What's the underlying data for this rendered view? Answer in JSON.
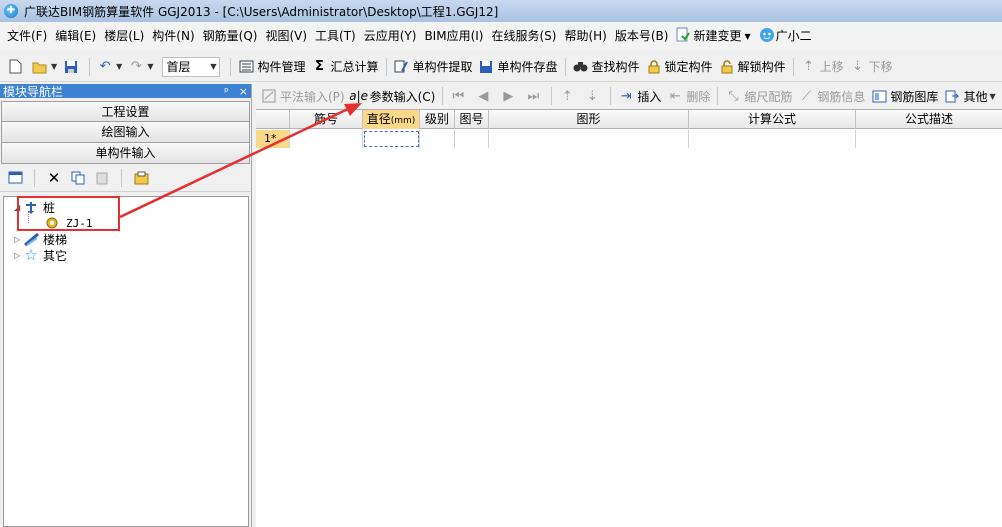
{
  "window": {
    "title": "广联达BIM钢筋算量软件 GGJ2013 - [C:\\Users\\Administrator\\Desktop\\工程1.GGJ12]"
  },
  "menu": {
    "items": [
      "文件(F)",
      "编辑(E)",
      "楼层(L)",
      "构件(N)",
      "钢筋量(Q)",
      "视图(V)",
      "工具(T)",
      "云应用(Y)",
      "BIM应用(I)",
      "在线服务(S)",
      "帮助(H)",
      "版本号(B)"
    ],
    "new_change": "新建变更",
    "assistant": "广小二"
  },
  "toolbar": {
    "floor": "首层",
    "component_manage": "构件管理",
    "summary_calc": "汇总计算",
    "single_extract": "单构件提取",
    "single_save": "单构件存盘",
    "find_component": "查找构件",
    "lock_component": "锁定构件",
    "unlock_component": "解锁构件",
    "move_up": "上移",
    "move_down": "下移",
    "sigma": "Σ"
  },
  "left_panel": {
    "title": "模块导航栏",
    "pin": "ᵖ",
    "close": "×",
    "sections": [
      "工程设置",
      "绘图输入",
      "单构件输入"
    ],
    "tree": {
      "pile_label": "桩",
      "pile_child": "ZJ-1",
      "stair_label": "楼梯",
      "other_label": "其它"
    }
  },
  "grid_toolbar": {
    "flat_input": "平法输入(P)",
    "param_input": "参数输入(C)",
    "insert": "插入",
    "delete": "删除",
    "scale_rebar": "缩尺配筋",
    "rebar_info": "钢筋信息",
    "rebar_library": "钢筋图库",
    "other": "其他"
  },
  "grid": {
    "columns": {
      "rebar_no": "筋号",
      "diameter": "直径",
      "diameter_unit": "(mm)",
      "grade": "级别",
      "figure_no": "图号",
      "shape": "图形",
      "formula": "计算公式",
      "formula_desc": "公式描述"
    },
    "row_label": "1*"
  },
  "colors": {
    "annotation_red": "#e53030",
    "highlight_header": "#fbd98b",
    "nav_title_bg": "#3d82d1"
  }
}
